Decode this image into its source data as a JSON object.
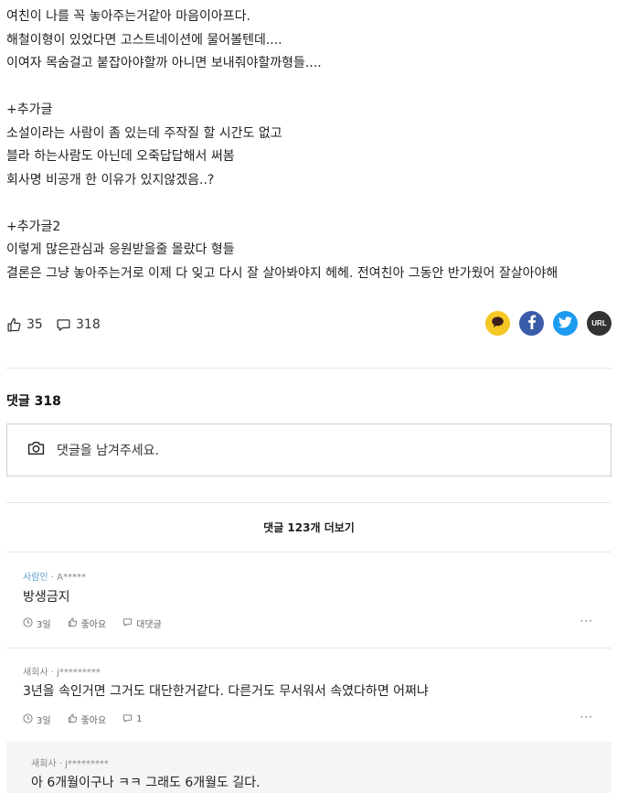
{
  "post": {
    "lines": [
      "여친이 나를 꼭 놓아주는거같아 마음이아프다.",
      "해철이형이 있었다면 고스트네이션에 물어볼텐데....",
      "이여자 목숨걸고 붙잡아야할까 아니면 보내줘야할까형들....",
      "",
      "+추가글",
      "소설이라는 사람이 좀 있는데 주작질 할 시간도 없고",
      "블라 하는사람도 아닌데 오죽답답해서 써봄",
      "회사명 비공개 한 이유가 있지않겠음..?",
      "",
      "+추가글2",
      "이렇게 많은관심과 응원받을줄 몰랐다 형들",
      "결론은 그냥 놓아주는거로 이제 다 잊고 다시 잘 살아봐야지 헤헤. 전여친아 그동안 반가웠어 잘살아야해"
    ]
  },
  "actions": {
    "like_count": "35",
    "comment_count": "318",
    "share": {
      "url_label": "URL"
    }
  },
  "comments_section": {
    "heading": "댓글 318",
    "write_placeholder": "댓글을 남겨주세요.",
    "more_label": "댓글 123개 더보기"
  },
  "comments": [
    {
      "company": "사람인",
      "author": "A*****",
      "text": "방생금지",
      "time": "3일",
      "like_label": "좋아요",
      "reply_label": "대댓글"
    },
    {
      "company": "새회사",
      "author": "j*********",
      "text": "3년을 속인거면 그거도 대단한거같다. 다른거도 무서워서 속였다하면 어쩌냐",
      "time": "3일",
      "like_label": "좋아요",
      "reply_count": "1"
    }
  ],
  "reply": {
    "company": "새회사",
    "author": "j*********",
    "text": "아 6개월이구나 ㅋㅋ 그래도 6개월도 길다."
  },
  "colors": {
    "kakao": "#f5c722",
    "facebook": "#3a5ba8",
    "twitter": "#1d9bf0",
    "url": "#333333",
    "company_accent": "#5a9ec9"
  }
}
